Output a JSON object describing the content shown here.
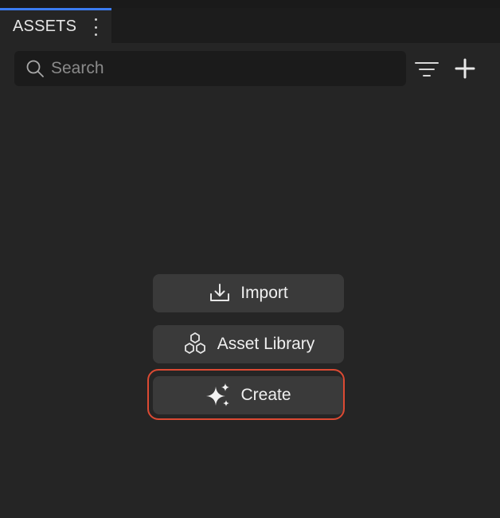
{
  "panel": {
    "tab_label": "ASSETS",
    "menu_icon": "kebab-menu-icon"
  },
  "search": {
    "placeholder": "Search",
    "value": "",
    "icon": "search-icon"
  },
  "toolbar": {
    "filter_icon": "filter-icon",
    "add_icon": "plus-icon"
  },
  "actions": {
    "import_label": "Import",
    "import_icon": "download-icon",
    "library_label": "Asset Library",
    "library_icon": "hexagons-icon",
    "create_label": "Create",
    "create_icon": "sparkles-icon"
  },
  "colors": {
    "accent": "#3b7bf0",
    "highlight": "#dc4a33",
    "background": "#252525",
    "button": "#3a3a3a"
  }
}
